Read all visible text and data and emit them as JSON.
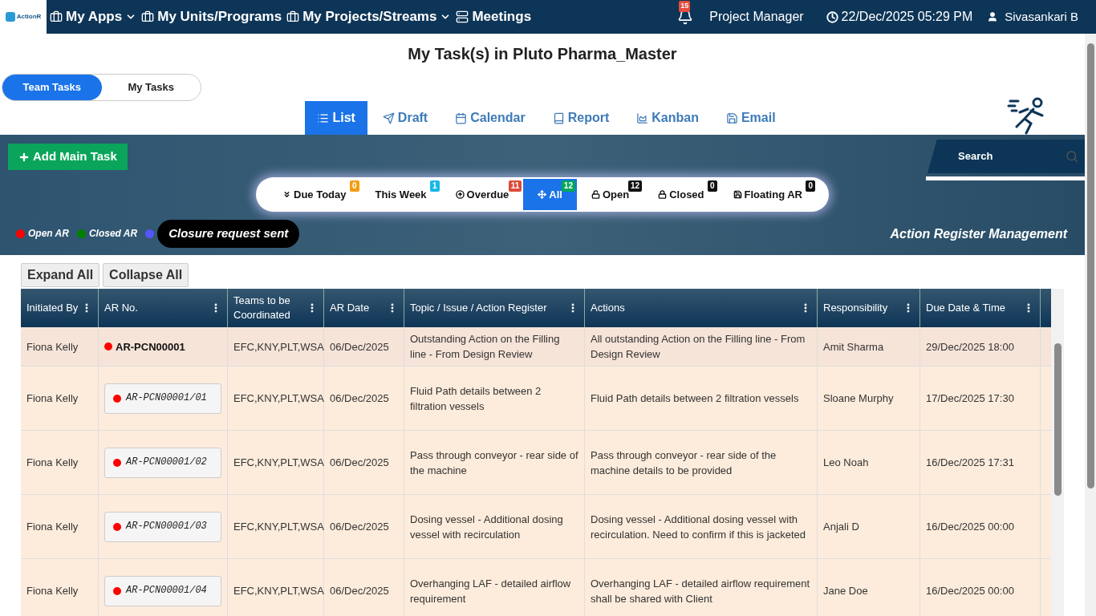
{
  "navbar": {
    "logo_text": "ActionR",
    "menus": [
      {
        "label": "My Apps",
        "has_menu": true
      },
      {
        "label": "My Units/Programs",
        "has_menu": false
      },
      {
        "label": "My Projects/Streams",
        "has_menu": true
      },
      {
        "label": "Meetings",
        "has_menu": false
      }
    ],
    "notification_count": "15",
    "role": "Project Manager",
    "datetime": "22/Dec/2025 05:29 PM",
    "user": "Sivasankari B"
  },
  "page_title": "My Task(s) in Pluto Pharma_Master",
  "scope_toggle": [
    {
      "label": "Team Tasks",
      "selected": true
    },
    {
      "label": "My Tasks",
      "selected": false
    }
  ],
  "view_tabs": [
    {
      "label": "List",
      "kind": "list",
      "selected": true
    },
    {
      "label": "Draft",
      "kind": "draft",
      "selected": false
    },
    {
      "label": "Calendar",
      "kind": "calendar",
      "selected": false
    },
    {
      "label": "Report",
      "kind": "report",
      "selected": false
    },
    {
      "label": "Kanban",
      "kind": "kanban",
      "selected": false
    },
    {
      "label": "Email",
      "kind": "email",
      "selected": false
    }
  ],
  "add_button": "Add Main Task",
  "search": {
    "placeholder": "Search"
  },
  "filters": [
    {
      "label": "Due Today",
      "kind": "due",
      "count": "0",
      "color": "#f39c12",
      "selected": false
    },
    {
      "label": "This Week",
      "kind": "week",
      "count": "1",
      "color": "#17b8e6",
      "selected": false
    },
    {
      "label": "Overdue",
      "kind": "overdue",
      "count": "11",
      "color": "#dd4b39",
      "selected": false
    },
    {
      "label": "All",
      "kind": "all",
      "count": "12",
      "color": "#00a65a",
      "selected": true
    },
    {
      "label": "Open",
      "kind": "open",
      "count": "12",
      "color": "#111111",
      "selected": false
    },
    {
      "label": "Closed",
      "kind": "closed",
      "count": "0",
      "color": "#111111",
      "selected": false
    },
    {
      "label": "Floating AR",
      "kind": "floating",
      "count": "0",
      "color": "#111111",
      "selected": false
    }
  ],
  "legend": [
    {
      "label": "Open AR",
      "color": "#ff0000",
      "kind": "plain"
    },
    {
      "label": "Closed AR",
      "color": "#008000",
      "kind": "plain"
    },
    {
      "label": "Closure request sent",
      "color": "#5555ff",
      "kind": "pill"
    }
  ],
  "banner_title": "Action Register Management",
  "buttons": [
    "Expand All",
    "Collapse All"
  ],
  "table": {
    "columns": [
      "Initiated By",
      "AR No.",
      "Teams to be Coordinated",
      "AR Date",
      "Topic / Issue / Action Register",
      "Actions",
      "Responsibility",
      "Due Date & Time"
    ],
    "rows": [
      {
        "kind": "main",
        "color": "#ff0000",
        "cells": [
          "Fiona Kelly",
          "AR-PCN00001",
          "EFC,KNY,PLT,WSA",
          "06/Dec/2025",
          "Outstanding Action on the Filling line - From Design Review",
          "All outstanding Action on the Filling line - From Design Review",
          "Amit Sharma",
          "29/Dec/2025 18:00"
        ]
      },
      {
        "kind": "sub",
        "color": "#ff0000",
        "cells": [
          "Fiona Kelly",
          "AR-PCN00001/01",
          "EFC,KNY,PLT,WSA",
          "06/Dec/2025",
          "Fluid Path details between 2 filtration vessels",
          "Fluid Path details between 2 filtration vessels",
          "Sloane Murphy",
          "17/Dec/2025 17:30"
        ]
      },
      {
        "kind": "sub",
        "color": "#ff0000",
        "cells": [
          "Fiona Kelly",
          "AR-PCN00001/02",
          "EFC,KNY,PLT,WSA",
          "06/Dec/2025",
          "Pass through conveyor - rear side of the machine",
          "Pass through conveyor - rear side of the machine details to be provided",
          "Leo Noah",
          "16/Dec/2025 17:31"
        ]
      },
      {
        "kind": "sub",
        "color": "#ff0000",
        "cells": [
          "Fiona Kelly",
          "AR-PCN00001/03",
          "EFC,KNY,PLT,WSA",
          "06/Dec/2025",
          "Dosing vessel - Additional dosing vessel with recirculation",
          "Dosing vessel - Additional dosing vessel with recirculation. Need to confirm if this is jacketed",
          "Anjali D",
          "16/Dec/2025 00:00"
        ]
      },
      {
        "kind": "sub",
        "color": "#ff0000",
        "cells": [
          "Fiona Kelly",
          "AR-PCN00001/04",
          "EFC,KNY,PLT,WSA",
          "06/Dec/2025",
          "Overhanging LAF - detailed airflow requirement",
          "Overhanging LAF - detailed airflow requirement shall be shared with Client",
          "Jane Doe",
          "16/Dec/2025 00:00"
        ]
      }
    ]
  }
}
